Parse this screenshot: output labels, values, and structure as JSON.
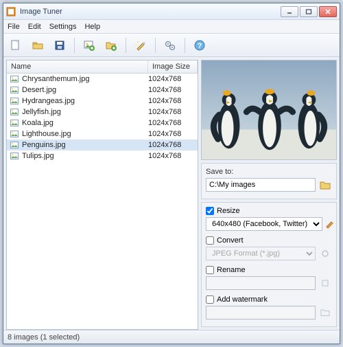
{
  "title": "Image Tuner",
  "menus": [
    "File",
    "Edit",
    "Settings",
    "Help"
  ],
  "columns": {
    "name": "Name",
    "size": "Image Size"
  },
  "files": [
    {
      "name": "Chrysanthemum.jpg",
      "size": "1024x768",
      "selected": false
    },
    {
      "name": "Desert.jpg",
      "size": "1024x768",
      "selected": false
    },
    {
      "name": "Hydrangeas.jpg",
      "size": "1024x768",
      "selected": false
    },
    {
      "name": "Jellyfish.jpg",
      "size": "1024x768",
      "selected": false
    },
    {
      "name": "Koala.jpg",
      "size": "1024x768",
      "selected": false
    },
    {
      "name": "Lighthouse.jpg",
      "size": "1024x768",
      "selected": false
    },
    {
      "name": "Penguins.jpg",
      "size": "1024x768",
      "selected": true
    },
    {
      "name": "Tulips.jpg",
      "size": "1024x768",
      "selected": false
    }
  ],
  "save_to_label": "Save to:",
  "save_path": "C:\\My images",
  "resize": {
    "label": "Resize",
    "checked": true,
    "value": "640x480 (Facebook, Twitter)"
  },
  "convert": {
    "label": "Convert",
    "checked": false,
    "value": "JPEG Format (*.jpg)"
  },
  "rename": {
    "label": "Rename",
    "checked": false,
    "value": ""
  },
  "watermark": {
    "label": "Add watermark",
    "checked": false,
    "value": ""
  },
  "status": "8 images (1 selected)"
}
